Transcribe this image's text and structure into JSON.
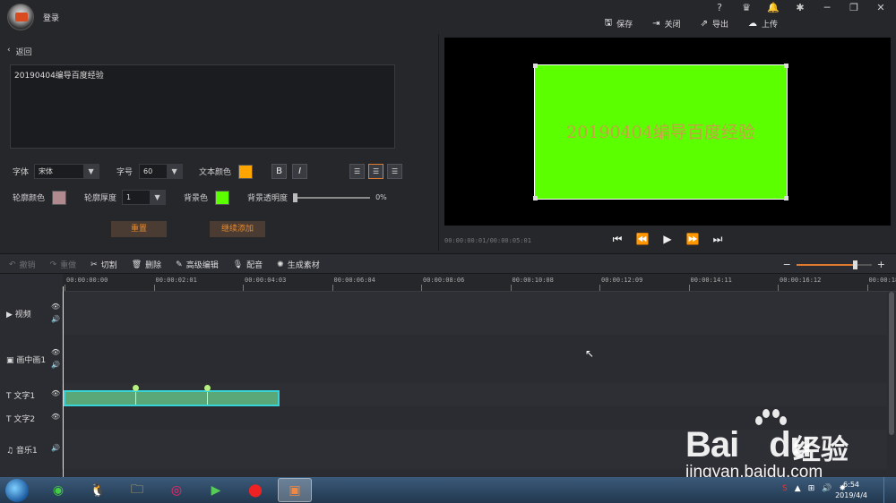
{
  "titlebar": {
    "login": "登录",
    "sys_icons": [
      "?",
      "VIP",
      "bell",
      "gear",
      "minimize",
      "restore",
      "close"
    ],
    "sys_glyphs": [
      "?",
      "♛",
      "🔔",
      "✱",
      "─",
      "❐",
      "✕"
    ],
    "save": "保存",
    "close": "关闭",
    "export": "导出",
    "upload": "上传"
  },
  "editor": {
    "back": "返回",
    "text": "20190404编导百度经验",
    "font_label": "字体",
    "font_value": "宋体",
    "size_label": "字号",
    "size_value": "60",
    "text_color_label": "文本颜色",
    "text_color": "#ffa500",
    "bold": "B",
    "italic": "I",
    "outline_color_label": "轮廓颜色",
    "outline_color": "#b08a8e",
    "outline_width_label": "轮廓厚度",
    "outline_width_value": "1",
    "bg_color_label": "背景色",
    "bg_color": "#5cff00",
    "bg_opacity_label": "背景透明度",
    "bg_opacity_value": "0%",
    "reset": "重置",
    "continue_add": "继续添加"
  },
  "preview": {
    "overlay_text": "20190404编导百度经验",
    "timecode": "00:00:00:01/00:00:05:01"
  },
  "edit_toolbar": {
    "undo": "撤销",
    "redo": "重做",
    "cut": "切割",
    "delete": "删除",
    "advanced_edit": "高级编辑",
    "dub": "配音",
    "generate": "生成素材",
    "zoom_minus": "−",
    "zoom_plus": "+",
    "zoom_level": 0.78
  },
  "timeline": {
    "ticks": [
      "00:00:00:00",
      "00:00:02:01",
      "00:00:04:03",
      "00:00:06:04",
      "00:00:08:06",
      "00:00:10:08",
      "00:00:12:09",
      "00:00:14:11",
      "00:00:16:12",
      "00:00:18:"
    ],
    "tracks": [
      {
        "name": "视频",
        "icon": "▶"
      },
      {
        "name": "画中画1",
        "icon": "▣"
      },
      {
        "name": "文字1",
        "icon": "T"
      },
      {
        "name": "文字2",
        "icon": "T"
      },
      {
        "name": "音乐1",
        "icon": "♫"
      }
    ]
  },
  "taskbar": {
    "time": "6:54",
    "date": "2019/4/4"
  },
  "watermark": {
    "brand": "Bai",
    "brand2": "du",
    "cn": "经验",
    "url": "jingyan.baidu.com"
  }
}
